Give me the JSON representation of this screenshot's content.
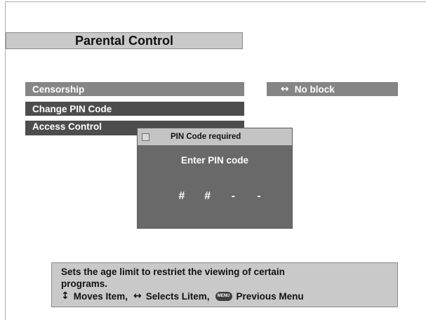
{
  "title": "Parental Control",
  "menu": {
    "items": [
      {
        "label": "Censorship"
      },
      {
        "label": "Change PIN Code"
      },
      {
        "label": "Access Control"
      }
    ]
  },
  "censorship_value": {
    "arrow": "↔",
    "label": "No block"
  },
  "pin_dialog": {
    "title": "PIN Code required",
    "prompt": "Enter PIN code",
    "digits": [
      "#",
      "#",
      "-",
      "-"
    ]
  },
  "help": {
    "description_line1": "Sets the age limit to restriet the viewing of certain",
    "description_line2": "programs.",
    "move_glyph": "↕",
    "move_text": "Moves Item,",
    "select_glyph": "↔",
    "select_text": "Selects Litem,",
    "menu_icon_text": "MENU",
    "menu_text": "Previous Menu"
  },
  "colors": {
    "panel_light": "#c9c9c9",
    "item_mid": "#858585",
    "item_dark": "#4d4d4d",
    "dialog_body": "#696969",
    "text_white": "#ffffff",
    "text_dark": "#111111"
  },
  "icons": {
    "censorship_value": "left-right-arrow-icon",
    "dialog": "checkbox-icon",
    "help_move": "up-down-arrow-icon",
    "help_select": "left-right-arrow-icon",
    "help_menu": "menu-button-icon"
  }
}
